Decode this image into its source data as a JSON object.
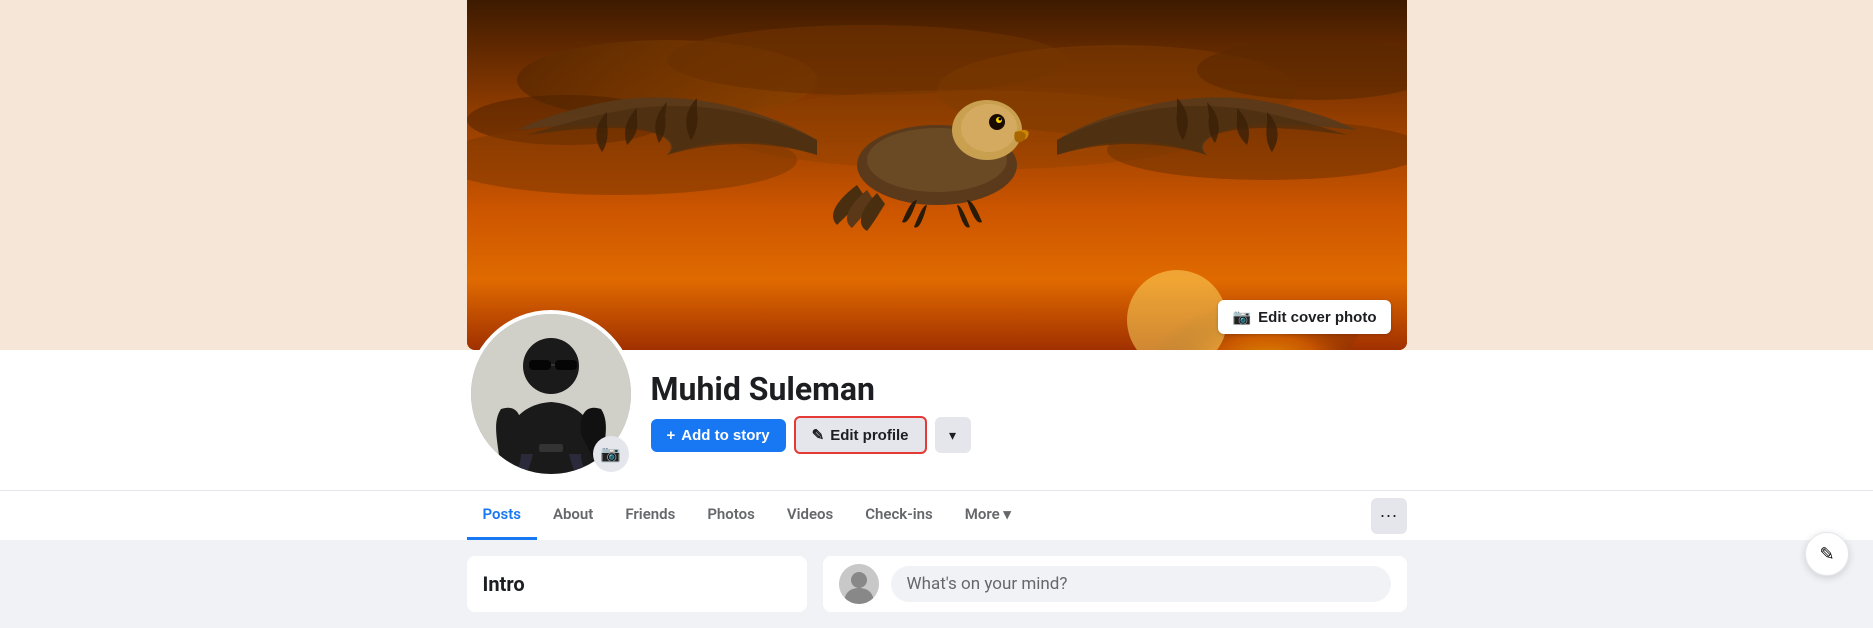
{
  "profile": {
    "name": "Muhid Suleman",
    "cover_alt": "Eagle flying against orange sunset sky"
  },
  "buttons": {
    "edit_cover_photo": "Edit cover photo",
    "add_to_story": "+ Add to story",
    "edit_profile": "✎ Edit profile",
    "dropdown_arrow": "▾"
  },
  "nav": {
    "tabs": [
      {
        "label": "Posts",
        "active": true
      },
      {
        "label": "About",
        "active": false
      },
      {
        "label": "Friends",
        "active": false
      },
      {
        "label": "Photos",
        "active": false
      },
      {
        "label": "Videos",
        "active": false
      },
      {
        "label": "Check-ins",
        "active": false
      },
      {
        "label": "More ▾",
        "active": false
      }
    ],
    "more_dots": "···"
  },
  "bottom": {
    "intro_title": "Intro",
    "post_placeholder": "What's on your mind?"
  },
  "icons": {
    "camera": "📷",
    "pencil": "✎",
    "plus": "+",
    "chevron_down": "▾",
    "three_dots": "···",
    "edit_box": "✎"
  }
}
